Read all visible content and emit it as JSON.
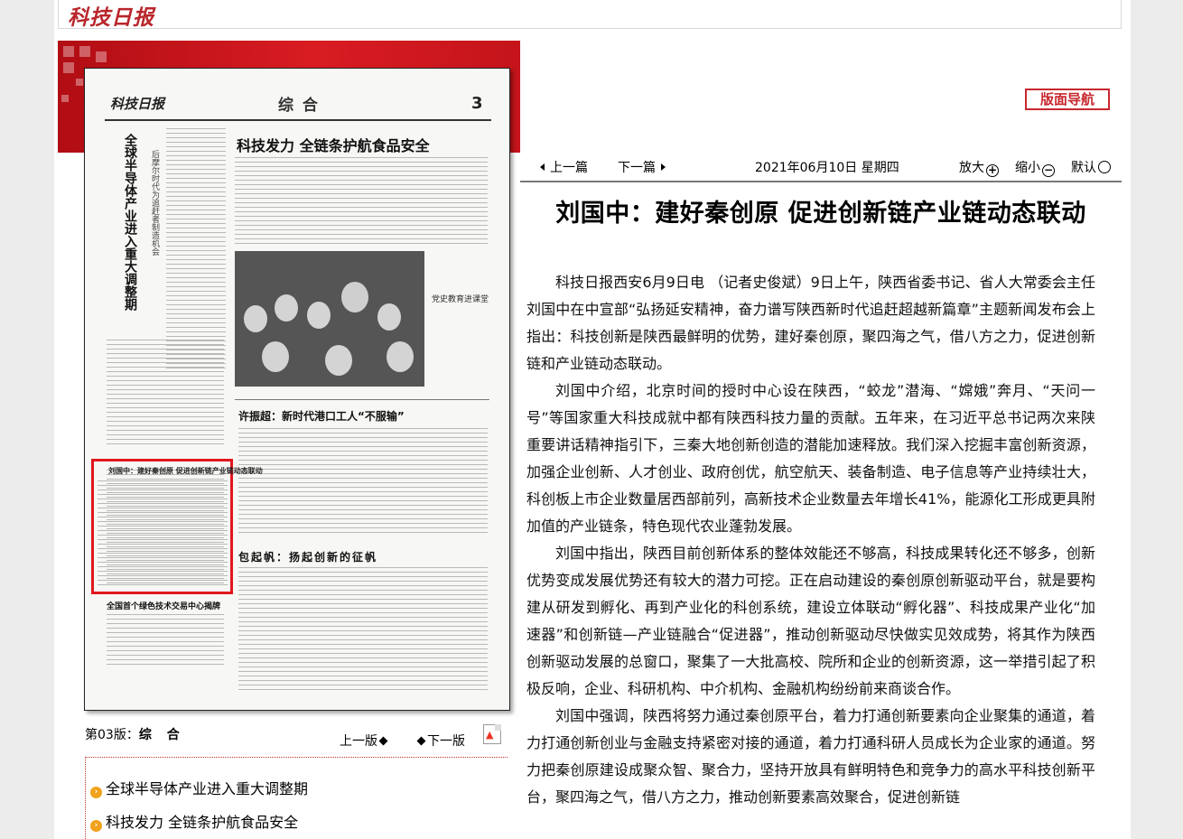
{
  "header": {
    "logo": "科技日报"
  },
  "paper_preview": {
    "logo": "科技日报",
    "section": "综 合",
    "page_num": "3",
    "lead_vertical_title": "全球半导体产业进入重大调整期",
    "lead_vertical_sub": "后摩尔时代为追赶者制造机会",
    "headline_top": "科技发力 全链条护航食品安全",
    "photo_caption": "党史教育进课堂",
    "headline_mid": "许振超：新时代港口工人“不服输”",
    "headline_low": "包起帆：扬起创新的征帆",
    "headline_left": "全国首个绿色技术交易中心揭牌",
    "highlight_title": "刘国中：建好秦创原 促进创新链产业链动态联动"
  },
  "toolbar": {
    "banshu_nav": "版面导航",
    "prev_article": "上一篇",
    "next_article": "下一篇",
    "date": "2021年06月10日 星期四",
    "zoom_in": "放大",
    "zoom_out": "缩小",
    "reset": "默认"
  },
  "article": {
    "title": "刘国中：建好秦创原 促进创新链产业链动态联动",
    "paragraphs": [
      "科技日报西安6月9日电 （记者史俊斌）9日上午，陕西省委书记、省人大常委会主任刘国中在中宣部“弘扬延安精神，奋力谱写陕西新时代追赶超越新篇章”主题新闻发布会上指出：科技创新是陕西最鲜明的优势，建好秦创原，聚四海之气，借八方之力，促进创新链和产业链动态联动。",
      "刘国中介绍，北京时间的授时中心设在陕西，“蛟龙”潜海、“嫦娥”奔月、“天问一号”等国家重大科技成就中都有陕西科技力量的贡献。五年来，在习近平总书记两次来陕重要讲话精神指引下，三秦大地创新创造的潜能加速释放。我们深入挖掘丰富创新资源，加强企业创新、人才创业、政府创优，航空航天、装备制造、电子信息等产业持续壮大，科创板上市企业数量居西部前列，高新技术企业数量去年增长41%，能源化工形成更具附加值的产业链条，特色现代农业蓬勃发展。",
      "刘国中指出，陕西目前创新体系的整体效能还不够高，科技成果转化还不够多，创新优势变成发展优势还有较大的潜力可挖。正在启动建设的秦创原创新驱动平台，就是要构建从研发到孵化、再到产业化的科创系统，建设立体联动“孵化器”、科技成果产业化“加速器”和创新链—产业链融合“促进器”，推动创新驱动尽快做实见效成势，将其作为陕西创新驱动发展的总窗口，聚集了一大批高校、院所和企业的创新资源，这一举措引起了积极反响，企业、科研机构、中介机构、金融机构纷纷前来商谈合作。",
      "刘国中强调，陕西将努力通过秦创原平台，着力打通创新要素向企业聚集的通道，着力打通创新创业与金融支持紧密对接的通道，着力打通科研人员成长为企业家的通道。努力把秦创原建设成聚众智、聚合力，坚持开放具有鲜明特色和竞争力的高水平科技创新平台，聚四海之气，借八方之力，推动创新要素高效聚合，促进创新链"
    ]
  },
  "page_nav": {
    "page_label_prefix": "第03版：",
    "page_label_name": "综 合",
    "prev_page": "上一版",
    "next_page": "下一版"
  },
  "article_list": [
    "全球半导体产业进入重大调整期",
    "科技发力 全链条护航食品安全"
  ]
}
